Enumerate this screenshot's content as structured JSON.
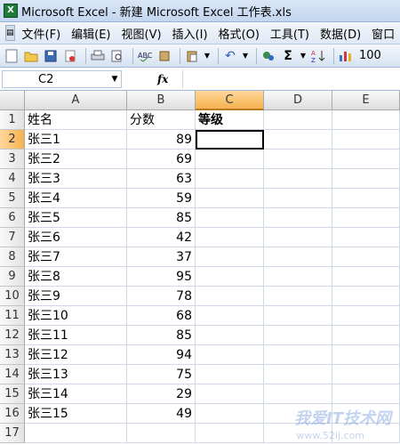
{
  "window": {
    "title": "Microsoft Excel - 新建 Microsoft Excel 工作表.xls",
    "app_icon": "X"
  },
  "menu": [
    "文件(F)",
    "编辑(E)",
    "视图(V)",
    "插入(I)",
    "格式(O)",
    "工具(T)",
    "数据(D)",
    "窗口"
  ],
  "toolbar": {
    "zoom": "100",
    "sigma": "Σ"
  },
  "formula_bar": {
    "name_box": "C2",
    "fx_label": "fx",
    "value": ""
  },
  "columns": [
    "A",
    "B",
    "C",
    "D",
    "E"
  ],
  "selected_column": "C",
  "rows": [
    {
      "num": "1",
      "a": "姓名",
      "b": "分数",
      "c": "等级"
    },
    {
      "num": "2",
      "a": "张三1",
      "b": "89",
      "c": ""
    },
    {
      "num": "3",
      "a": "张三2",
      "b": "69",
      "c": ""
    },
    {
      "num": "4",
      "a": "张三3",
      "b": "63",
      "c": ""
    },
    {
      "num": "5",
      "a": "张三4",
      "b": "59",
      "c": ""
    },
    {
      "num": "6",
      "a": "张三5",
      "b": "85",
      "c": ""
    },
    {
      "num": "7",
      "a": "张三6",
      "b": "42",
      "c": ""
    },
    {
      "num": "8",
      "a": "张三7",
      "b": "37",
      "c": ""
    },
    {
      "num": "9",
      "a": "张三8",
      "b": "95",
      "c": ""
    },
    {
      "num": "10",
      "a": "张三9",
      "b": "78",
      "c": ""
    },
    {
      "num": "11",
      "a": "张三10",
      "b": "68",
      "c": ""
    },
    {
      "num": "12",
      "a": "张三11",
      "b": "85",
      "c": ""
    },
    {
      "num": "13",
      "a": "张三12",
      "b": "94",
      "c": ""
    },
    {
      "num": "14",
      "a": "张三13",
      "b": "75",
      "c": ""
    },
    {
      "num": "15",
      "a": "张三14",
      "b": "29",
      "c": ""
    },
    {
      "num": "16",
      "a": "张三15",
      "b": "49",
      "c": ""
    },
    {
      "num": "17",
      "a": "",
      "b": "",
      "c": ""
    }
  ],
  "watermark": {
    "main": "我爱IT技术网",
    "sub": "www.52ij.com"
  }
}
